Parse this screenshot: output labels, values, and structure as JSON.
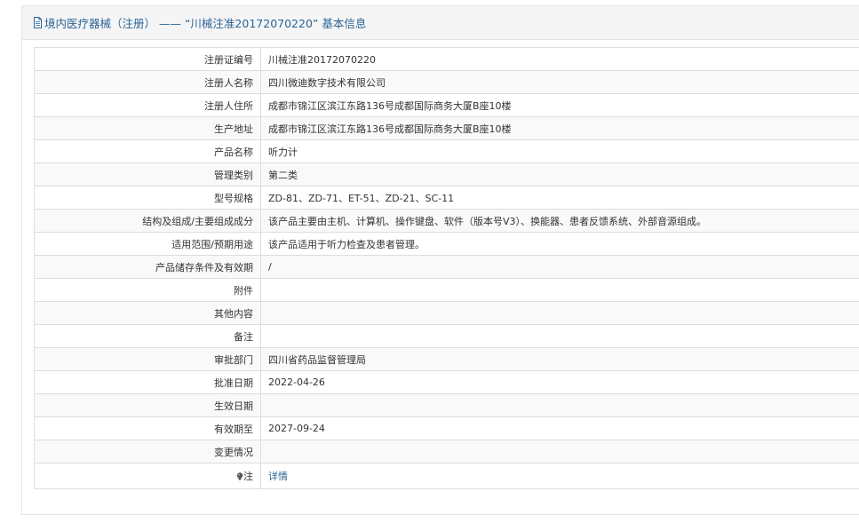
{
  "panel": {
    "title": "境内医疗器械（注册） —— “川械注准20172070220” 基本信息",
    "icon": "document-icon"
  },
  "rows": [
    {
      "label": "注册证编号",
      "value": "川械注准20172070220"
    },
    {
      "label": "注册人名称",
      "value": "四川微迪数字技术有限公司"
    },
    {
      "label": "注册人住所",
      "value": "成都市锦江区滨江东路136号成都国际商务大厦B座10楼"
    },
    {
      "label": "生产地址",
      "value": "成都市锦江区滨江东路136号成都国际商务大厦B座10楼"
    },
    {
      "label": "产品名称",
      "value": "听力计"
    },
    {
      "label": "管理类别",
      "value": "第二类"
    },
    {
      "label": "型号规格",
      "value": "ZD-81、ZD-71、ET-51、ZD-21、SC-11"
    },
    {
      "label": "结构及组成/主要组成成分",
      "value": "该产品主要由主机、计算机、操作键盘、软件（版本号V3）、换能器、患者反馈系统、外部音源组成。"
    },
    {
      "label": "适用范围/预期用途",
      "value": "该产品适用于听力检查及患者管理。"
    },
    {
      "label": "产品储存条件及有效期",
      "value": "/"
    },
    {
      "label": "附件",
      "value": ""
    },
    {
      "label": "其他内容",
      "value": ""
    },
    {
      "label": "备注",
      "value": ""
    },
    {
      "label": "审批部门",
      "value": "四川省药品监督管理局"
    },
    {
      "label": "批准日期",
      "value": "2022-04-26"
    },
    {
      "label": "生效日期",
      "value": ""
    },
    {
      "label": "有效期至",
      "value": "2027-09-24"
    },
    {
      "label": "变更情况",
      "value": ""
    }
  ],
  "note_row": {
    "label": "注",
    "icon": "lightbulb-icon",
    "link_text": "详情"
  },
  "colors": {
    "title": "#2a6496",
    "link": "#2a6496",
    "header_bg": "#f5f5f5",
    "row_alt_bg": "#f9f9f9",
    "border": "#dddddd"
  }
}
